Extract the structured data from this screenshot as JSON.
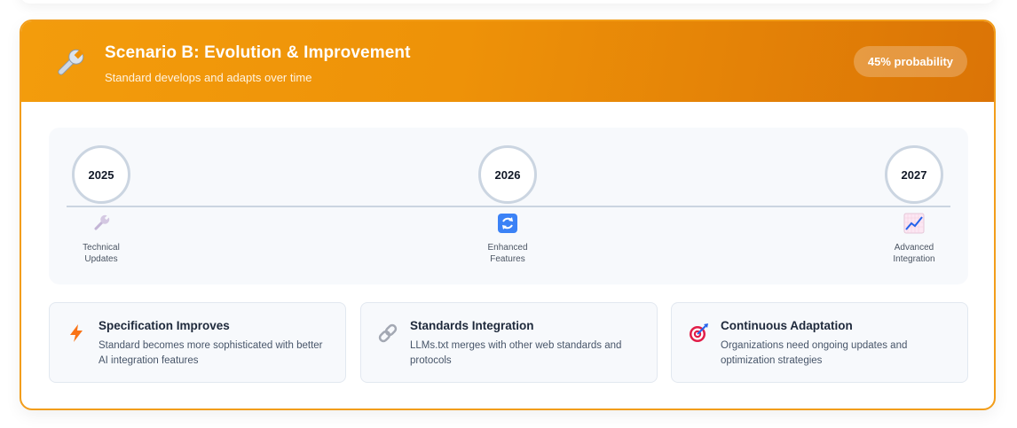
{
  "scenario": {
    "title": "Scenario B: Evolution & Improvement",
    "subtitle": "Standard develops and adapts over time",
    "probability": "45% probability",
    "icon": "wrench-icon",
    "accent_color": "#f29d1a"
  },
  "timeline": [
    {
      "year": "2025",
      "icon": "wrench-icon",
      "label": "Technical\nUpdates"
    },
    {
      "year": "2026",
      "icon": "refresh-icon",
      "label": "Enhanced\nFeatures"
    },
    {
      "year": "2027",
      "icon": "chart-up-icon",
      "label": "Advanced\nIntegration"
    }
  ],
  "features": [
    {
      "icon": "lightning-icon",
      "title": "Specification Improves",
      "description": "Standard becomes more sophisticated with better AI integration features"
    },
    {
      "icon": "link-icon",
      "title": "Standards Integration",
      "description": "LLMs.txt merges with other web standards and protocols"
    },
    {
      "icon": "target-icon",
      "title": "Continuous Adaptation",
      "description": "Organizations need ongoing updates and optimization strategies"
    }
  ]
}
